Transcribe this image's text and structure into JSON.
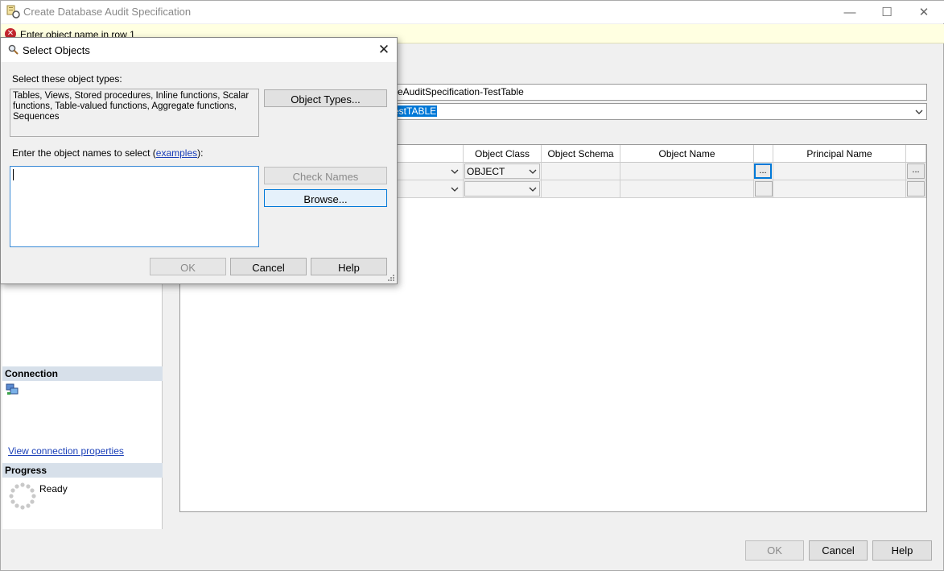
{
  "main_window": {
    "title": "Create Database Audit Specification",
    "controls": {
      "minimize": "—",
      "maximize": "☐",
      "close": "✕"
    }
  },
  "error_bar": {
    "icon": "error-icon",
    "message": "Enter object name in row 1"
  },
  "left_panel": {
    "connection_header": "Connection",
    "view_connection_link": "View connection properties",
    "progress_header": "Progress",
    "progress_status": "Ready"
  },
  "form": {
    "name_value": "seAuditSpecification-TestTable",
    "audit_selected": "estTABLE"
  },
  "grid": {
    "columns": [
      "Object Class",
      "Object Schema",
      "Object Name",
      "Principal Name"
    ],
    "rows": [
      {
        "object_class": "OBJECT",
        "ellipsis": "...",
        "principal_ellipsis": "..."
      },
      {
        "object_class": "",
        "ellipsis": "",
        "principal_ellipsis": ""
      }
    ]
  },
  "main_buttons": {
    "ok": "OK",
    "cancel": "Cancel",
    "help": "Help"
  },
  "dialog": {
    "title": "Select Objects",
    "close": "✕",
    "types_label": "Select these object types:",
    "types_value": "Tables, Views, Stored procedures, Inline functions, Scalar functions, Table-valued functions, Aggregate functions, Sequences",
    "object_types_button": "Object Types...",
    "names_label_prefix": "Enter the object names to select (",
    "names_label_link": "examples",
    "names_label_suffix": "):",
    "names_value": "",
    "check_names_button": "Check Names",
    "browse_button": "Browse...",
    "ok_button": "OK",
    "cancel_button": "Cancel",
    "help_button": "Help"
  }
}
